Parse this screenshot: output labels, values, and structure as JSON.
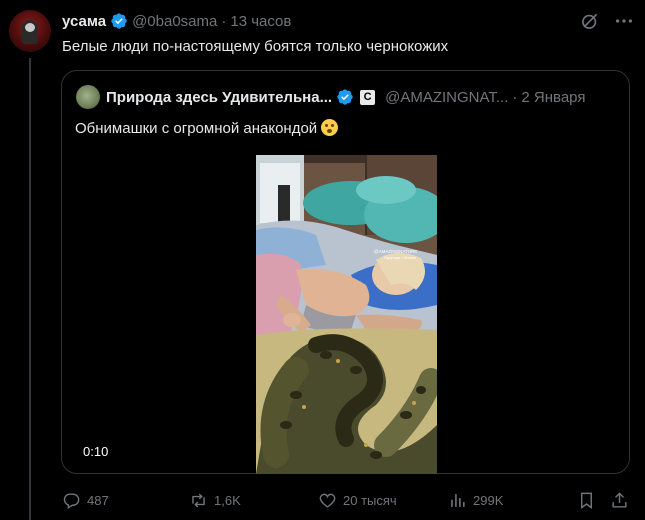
{
  "tweet": {
    "author_name": "усама",
    "handle": "@0ba0sama",
    "separator": "·",
    "time": "13 часов",
    "text": "Белые люди по-настоящему боятся только чернокожих",
    "avatar_icon": "profile-avatar"
  },
  "quote": {
    "author_name": "Природа здесь Удивительна...",
    "badge": "C",
    "handle": "@AMAZINGNAT...",
    "separator": "·",
    "date": "2 Января",
    "text": "Обнимашки с огромной анакондой",
    "emoji": "flushed-face",
    "video_duration": "0:10",
    "video_watermark_line1": "@AMAZINGNATURE",
    "video_watermark_line2": "Природа • Жизнь"
  },
  "actions": {
    "replies": "487",
    "reposts": "1,6K",
    "likes": "20 тысяч",
    "views": "299K"
  },
  "colors": {
    "background": "#000000",
    "text": "#e7e9ea",
    "muted": "#71767b",
    "verified": "#1d9bf0",
    "border": "#2f3336"
  }
}
